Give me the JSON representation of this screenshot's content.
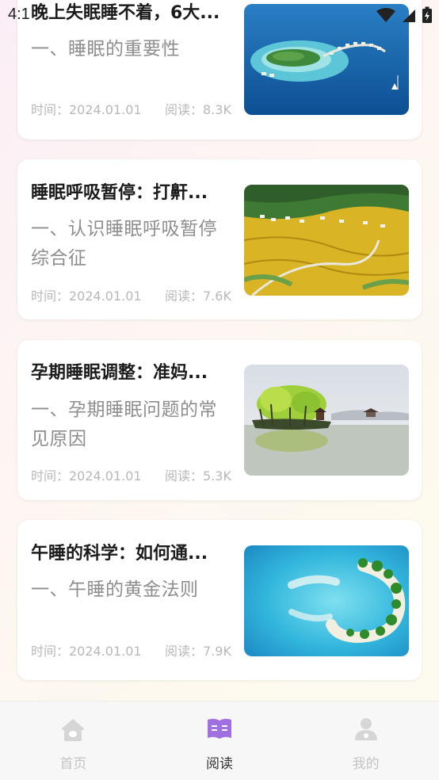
{
  "status_bar": {
    "time": "4:1"
  },
  "articles": [
    {
      "title": "晚上失眠睡不着，6大...",
      "summary": "一、睡眠的重要性",
      "time": "时间：2024.01.01",
      "reads": "阅读：8.3K",
      "image": "island-resort-photo"
    },
    {
      "title": "睡眠呼吸暂停：打鼾...",
      "summary": "一、认识睡眠呼吸暂停综合征",
      "time": "时间：2024.01.01",
      "reads": "阅读：7.6K",
      "image": "rice-terraces-photo"
    },
    {
      "title": "孕期睡眠调整：准妈...",
      "summary": "一、孕期睡眠问题的常见原因",
      "time": "时间：2024.01.01",
      "reads": "阅读：5.3K",
      "image": "lake-pavilion-photo"
    },
    {
      "title": "午睡的科学：如何通...",
      "summary": "一、午睡的黄金法则",
      "time": "时间：2024.01.01",
      "reads": "阅读：7.9K",
      "image": "palm-island-photo"
    }
  ],
  "tabbar": {
    "home": {
      "label": "首页",
      "icon": "home-icon"
    },
    "read": {
      "label": "阅读",
      "icon": "book-icon"
    },
    "mine": {
      "label": "我的",
      "icon": "user-icon"
    },
    "active": "read",
    "active_color": "#a070e0",
    "inactive_color": "#d6d6d6"
  }
}
